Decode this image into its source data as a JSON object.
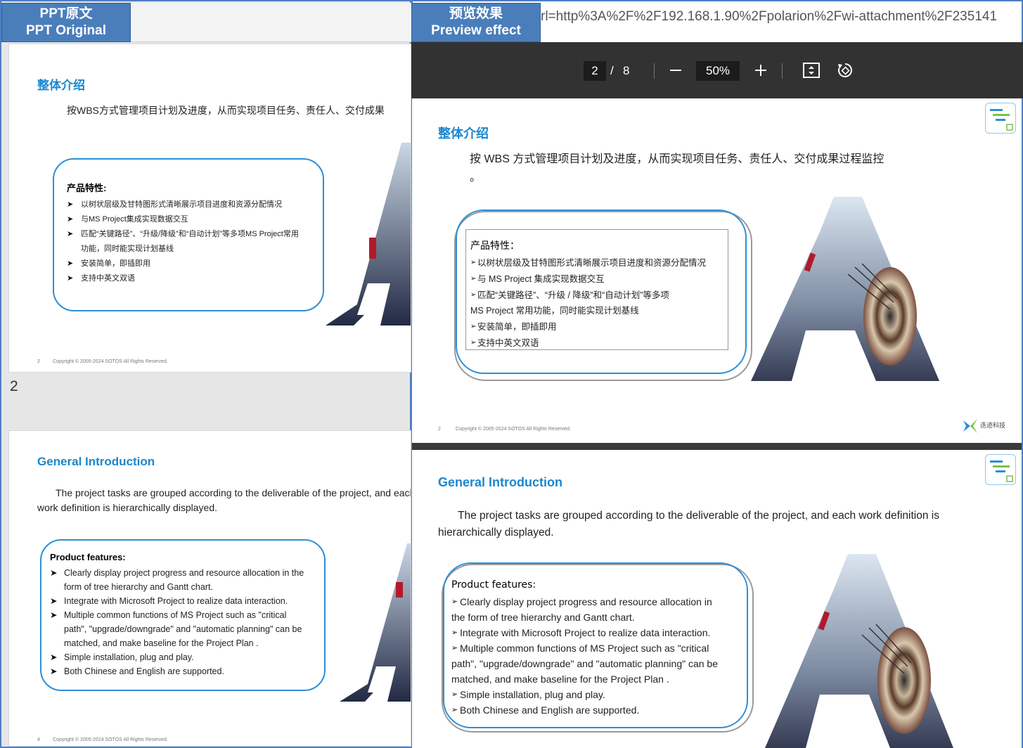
{
  "labels": {
    "left_cn": "PPT原文",
    "left_en": "PPT Original",
    "right_cn": "预览效果",
    "right_en": "Preview effect"
  },
  "browser": {
    "url_fragment": "rl=http%3A%2F%2F192.168.1.90%2Fpolarion%2Fwi-attachment%2F235141"
  },
  "viewer": {
    "current_page": "2",
    "page_separator": "/",
    "total_pages": "8",
    "zoom": "50%"
  },
  "left": {
    "page_number_label": "2",
    "slide_cn": {
      "title": "整体介绍",
      "body": "按WBS方式管理项目计划及进度，从而实现项目任务、责任人、交付成果",
      "features_title": "产品特性:",
      "features": [
        "以树状层级及甘特图形式清晰展示项目进度和资源分配情况",
        "与MS Project集成实现数据交互",
        "匹配“关键路径”、“升级/降级”和“自动计划”等多项MS Project常用功能，同时能实现计划基线",
        "安装简单，即插即用",
        "支持中英文双语"
      ],
      "page_no": "2",
      "copyright": "Copyright © 2005-2024 SOTOS All Rights Reserved."
    },
    "slide_en": {
      "title": "General Introduction",
      "body": "The project tasks are grouped according to the deliverable of the project, and each work definition is hierarchically displayed.",
      "features_title": "Product features:",
      "features": [
        "Clearly display project progress and resource allocation in the form of tree hierarchy and Gantt chart.",
        "Integrate with Microsoft Project to realize data interaction.",
        "Multiple common functions of MS Project such as \"critical path\", \"upgrade/downgrade\" and \"automatic planning\" can be matched, and make baseline for the Project Plan .",
        "Simple installation, plug and play.",
        "Both Chinese and English are supported."
      ],
      "page_no": "4",
      "copyright": "Copyright © 2005-2024 SOTOS All Rights Reserved."
    }
  },
  "right": {
    "slide_cn": {
      "title": "整体介绍",
      "body": "按 WBS 方式管理项目计划及进度，从而实现项目任务、责任人、交付成果过程监控",
      "body_tail": "。",
      "features_title": "产品特性：",
      "features": [
        "以树状层级及甘特图形式清晰展示项目进度和资源分配情况",
        "与 MS Project 集成实现数据交互",
        "匹配“关键路径”、“升级 / 降级”和“自动计划”等多项",
        "MS Project 常用功能，同时能实现计划基线",
        "安装简单，即插即用",
        "支持中英文双语"
      ],
      "page_no": "2",
      "copyright": "Copyright © 2005-2024 SOTOS All Rights Reserved.",
      "company": "迭迹科技"
    },
    "slide_en": {
      "title": "General Introduction",
      "body": "The project tasks are grouped according to the deliverable of the project, and each work definition is hierarchically displayed.",
      "features_title": "Product features:",
      "features": [
        "Clearly display project progress and resource allocation in the form of tree hierarchy and Gantt chart.",
        "Integrate with Microsoft Project to realize data interaction.",
        "Multiple common functions of MS Project such as \"critical path\", \"upgrade/downgrade\" and \"automatic planning\" can be matched, and make baseline for the Project Plan .",
        "Simple installation, plug and play.",
        "Both Chinese and English are supported."
      ]
    }
  },
  "colors": {
    "label_bg": "#4a7ebb",
    "title_blue": "#1b87cd",
    "box_blue": "#2c8fd6",
    "toolbar_bg": "#323232"
  }
}
